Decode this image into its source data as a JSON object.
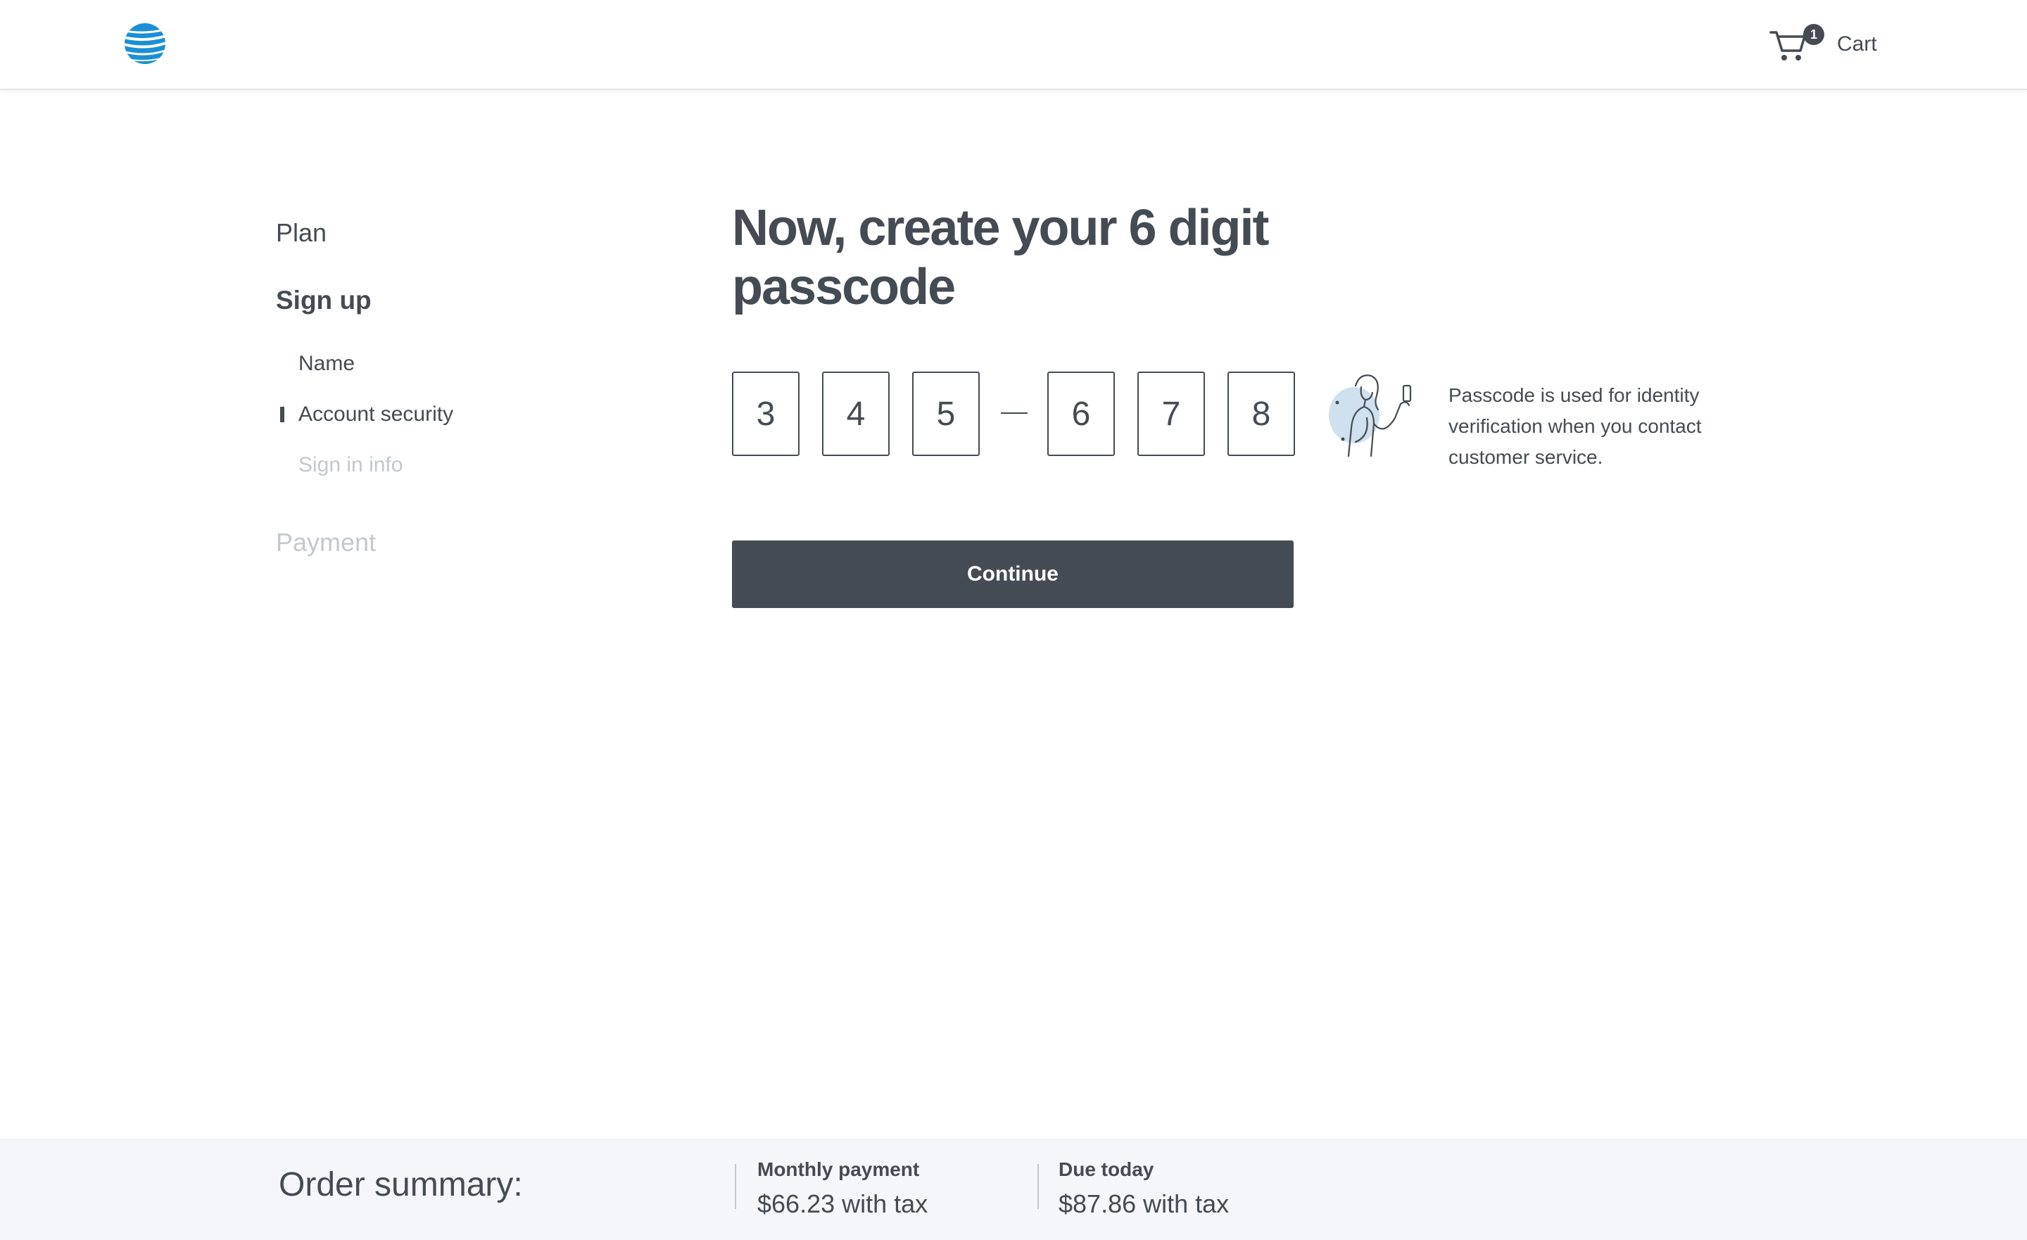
{
  "header": {
    "logo_icon": "att-globe-icon",
    "logo_color": "#1a8fd6",
    "cart": {
      "label": "Cart",
      "count": "1"
    }
  },
  "sidebar": {
    "plan": "Plan",
    "signup": "Sign up",
    "steps": [
      {
        "label": "Name",
        "state": "done"
      },
      {
        "label": "Account security",
        "state": "current"
      },
      {
        "label": "Sign in info",
        "state": "upcoming"
      }
    ],
    "payment": "Payment"
  },
  "main": {
    "title": "Now, create your 6 digit passcode",
    "passcode": [
      "3",
      "4",
      "5",
      "6",
      "7",
      "8"
    ],
    "help_text": "Passcode is used for identity verification when you contact customer service.",
    "illustration_icon": "woman-with-phone-illustration",
    "continue_label": "Continue"
  },
  "summary": {
    "title": "Order summary:",
    "monthly_label": "Monthly payment",
    "monthly_value": "$66.23 with tax",
    "due_label": "Due today",
    "due_value": "$87.86 with tax"
  }
}
